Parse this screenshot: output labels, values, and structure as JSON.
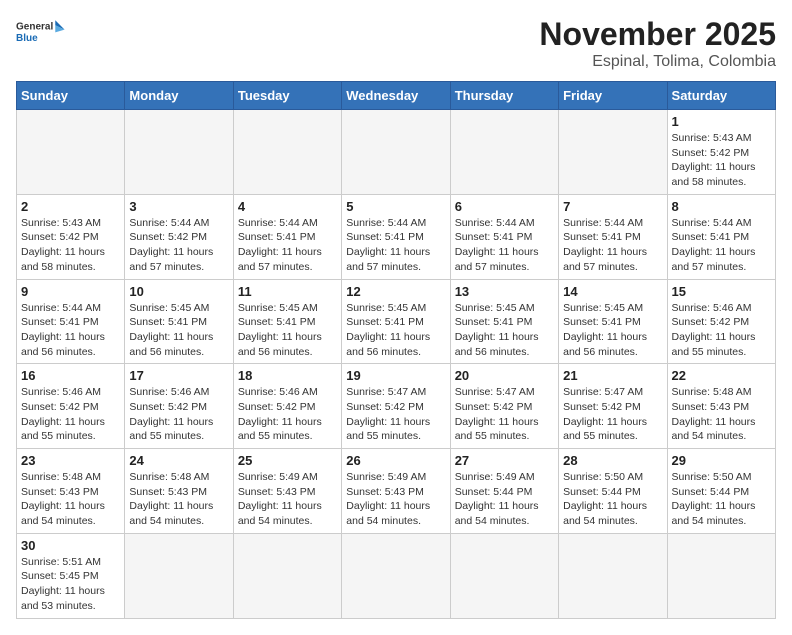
{
  "header": {
    "logo_general": "General",
    "logo_blue": "Blue",
    "month_title": "November 2025",
    "location": "Espinal, Tolima, Colombia"
  },
  "weekdays": [
    "Sunday",
    "Monday",
    "Tuesday",
    "Wednesday",
    "Thursday",
    "Friday",
    "Saturday"
  ],
  "weeks": [
    [
      {
        "day": "",
        "info": ""
      },
      {
        "day": "",
        "info": ""
      },
      {
        "day": "",
        "info": ""
      },
      {
        "day": "",
        "info": ""
      },
      {
        "day": "",
        "info": ""
      },
      {
        "day": "",
        "info": ""
      },
      {
        "day": "1",
        "info": "Sunrise: 5:43 AM\nSunset: 5:42 PM\nDaylight: 11 hours\nand 58 minutes."
      }
    ],
    [
      {
        "day": "2",
        "info": "Sunrise: 5:43 AM\nSunset: 5:42 PM\nDaylight: 11 hours\nand 58 minutes."
      },
      {
        "day": "3",
        "info": "Sunrise: 5:44 AM\nSunset: 5:42 PM\nDaylight: 11 hours\nand 57 minutes."
      },
      {
        "day": "4",
        "info": "Sunrise: 5:44 AM\nSunset: 5:41 PM\nDaylight: 11 hours\nand 57 minutes."
      },
      {
        "day": "5",
        "info": "Sunrise: 5:44 AM\nSunset: 5:41 PM\nDaylight: 11 hours\nand 57 minutes."
      },
      {
        "day": "6",
        "info": "Sunrise: 5:44 AM\nSunset: 5:41 PM\nDaylight: 11 hours\nand 57 minutes."
      },
      {
        "day": "7",
        "info": "Sunrise: 5:44 AM\nSunset: 5:41 PM\nDaylight: 11 hours\nand 57 minutes."
      },
      {
        "day": "8",
        "info": "Sunrise: 5:44 AM\nSunset: 5:41 PM\nDaylight: 11 hours\nand 57 minutes."
      }
    ],
    [
      {
        "day": "9",
        "info": "Sunrise: 5:44 AM\nSunset: 5:41 PM\nDaylight: 11 hours\nand 56 minutes."
      },
      {
        "day": "10",
        "info": "Sunrise: 5:45 AM\nSunset: 5:41 PM\nDaylight: 11 hours\nand 56 minutes."
      },
      {
        "day": "11",
        "info": "Sunrise: 5:45 AM\nSunset: 5:41 PM\nDaylight: 11 hours\nand 56 minutes."
      },
      {
        "day": "12",
        "info": "Sunrise: 5:45 AM\nSunset: 5:41 PM\nDaylight: 11 hours\nand 56 minutes."
      },
      {
        "day": "13",
        "info": "Sunrise: 5:45 AM\nSunset: 5:41 PM\nDaylight: 11 hours\nand 56 minutes."
      },
      {
        "day": "14",
        "info": "Sunrise: 5:45 AM\nSunset: 5:41 PM\nDaylight: 11 hours\nand 56 minutes."
      },
      {
        "day": "15",
        "info": "Sunrise: 5:46 AM\nSunset: 5:42 PM\nDaylight: 11 hours\nand 55 minutes."
      }
    ],
    [
      {
        "day": "16",
        "info": "Sunrise: 5:46 AM\nSunset: 5:42 PM\nDaylight: 11 hours\nand 55 minutes."
      },
      {
        "day": "17",
        "info": "Sunrise: 5:46 AM\nSunset: 5:42 PM\nDaylight: 11 hours\nand 55 minutes."
      },
      {
        "day": "18",
        "info": "Sunrise: 5:46 AM\nSunset: 5:42 PM\nDaylight: 11 hours\nand 55 minutes."
      },
      {
        "day": "19",
        "info": "Sunrise: 5:47 AM\nSunset: 5:42 PM\nDaylight: 11 hours\nand 55 minutes."
      },
      {
        "day": "20",
        "info": "Sunrise: 5:47 AM\nSunset: 5:42 PM\nDaylight: 11 hours\nand 55 minutes."
      },
      {
        "day": "21",
        "info": "Sunrise: 5:47 AM\nSunset: 5:42 PM\nDaylight: 11 hours\nand 55 minutes."
      },
      {
        "day": "22",
        "info": "Sunrise: 5:48 AM\nSunset: 5:43 PM\nDaylight: 11 hours\nand 54 minutes."
      }
    ],
    [
      {
        "day": "23",
        "info": "Sunrise: 5:48 AM\nSunset: 5:43 PM\nDaylight: 11 hours\nand 54 minutes."
      },
      {
        "day": "24",
        "info": "Sunrise: 5:48 AM\nSunset: 5:43 PM\nDaylight: 11 hours\nand 54 minutes."
      },
      {
        "day": "25",
        "info": "Sunrise: 5:49 AM\nSunset: 5:43 PM\nDaylight: 11 hours\nand 54 minutes."
      },
      {
        "day": "26",
        "info": "Sunrise: 5:49 AM\nSunset: 5:43 PM\nDaylight: 11 hours\nand 54 minutes."
      },
      {
        "day": "27",
        "info": "Sunrise: 5:49 AM\nSunset: 5:44 PM\nDaylight: 11 hours\nand 54 minutes."
      },
      {
        "day": "28",
        "info": "Sunrise: 5:50 AM\nSunset: 5:44 PM\nDaylight: 11 hours\nand 54 minutes."
      },
      {
        "day": "29",
        "info": "Sunrise: 5:50 AM\nSunset: 5:44 PM\nDaylight: 11 hours\nand 54 minutes."
      }
    ],
    [
      {
        "day": "30",
        "info": "Sunrise: 5:51 AM\nSunset: 5:45 PM\nDaylight: 11 hours\nand 53 minutes."
      },
      {
        "day": "",
        "info": ""
      },
      {
        "day": "",
        "info": ""
      },
      {
        "day": "",
        "info": ""
      },
      {
        "day": "",
        "info": ""
      },
      {
        "day": "",
        "info": ""
      },
      {
        "day": "",
        "info": ""
      }
    ]
  ]
}
